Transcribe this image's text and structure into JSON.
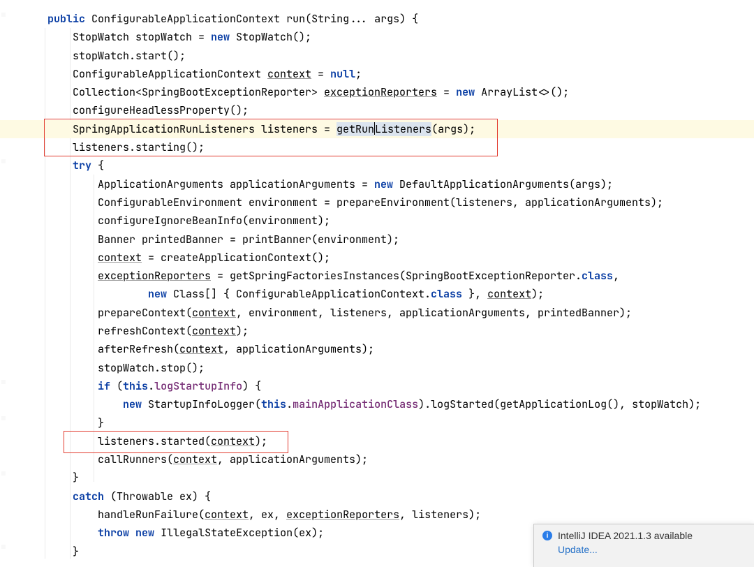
{
  "code": {
    "l1": {
      "kw1": "public",
      "type": "ConfigurableApplicationContext",
      "name": "run",
      "sig": "(String... args) {"
    },
    "l2": {
      "a": "StopWatch stopWatch = ",
      "kw": "new",
      "b": " StopWatch();"
    },
    "l3": "stopWatch.start();",
    "l4": {
      "a": "ConfigurableApplicationContext ",
      "u": "context",
      "b": " = ",
      "kw": "null",
      "c": ";"
    },
    "l5": {
      "a": "Collection<SpringBootExceptionReporter> ",
      "u": "exceptionReporters",
      "b": " = ",
      "kw": "new",
      "c": " ArrayList<>();"
    },
    "l6": "configureHeadlessProperty();",
    "l7": {
      "a": "SpringApplicationRunListeners listeners = ",
      "sel1": "getRun",
      "sel2": "Listeners",
      "b": "(args);"
    },
    "l8": "listeners.starting();",
    "l9": {
      "kw": "try",
      "b": " {"
    },
    "l10": {
      "a": "ApplicationArguments applicationArguments = ",
      "kw": "new",
      "b": " DefaultApplicationArguments(args);"
    },
    "l11": "ConfigurableEnvironment environment = prepareEnvironment(listeners, applicationArguments);",
    "l12": "configureIgnoreBeanInfo(environment);",
    "l13": "Banner printedBanner = printBanner(environment);",
    "l14": {
      "u": "context",
      "b": " = createApplicationContext();"
    },
    "l15": {
      "u": "exceptionReporters",
      "b": " = getSpringFactoriesInstances(SpringBootExceptionReporter.",
      "kw": "class",
      "c": ","
    },
    "l16": {
      "kw": "new",
      "a": " Class[] { ConfigurableApplicationContext.",
      "kw2": "class",
      "b": " }, ",
      "u": "context",
      "c": ");"
    },
    "l17": {
      "a": "prepareContext(",
      "u": "context",
      "b": ", environment, listeners, applicationArguments, printedBanner);"
    },
    "l18": {
      "a": "refreshContext(",
      "u": "context",
      "b": ");"
    },
    "l19": {
      "a": "afterRefresh(",
      "u": "context",
      "b": ", applicationArguments);"
    },
    "l20": "stopWatch.stop();",
    "l21": {
      "kw": "if",
      "a": " (",
      "kw2": "this",
      "b": ".",
      "fld": "logStartupInfo",
      "c": ") {"
    },
    "l22": {
      "kw": "new",
      "a": " StartupInfoLogger(",
      "kw2": "this",
      "b": ".",
      "fld": "mainApplicationClass",
      "c": ").logStarted(getApplicationLog(), stopWatch);"
    },
    "l23": "}",
    "l24": {
      "a": "listeners.started(",
      "u": "context",
      "b": ");"
    },
    "l25": {
      "a": "callRunners(",
      "u": "context",
      "b": ", applicationArguments);"
    },
    "l26": "}",
    "l27": {
      "kw": "catch",
      "a": " (Throwable ex) {"
    },
    "l28": {
      "a": "handleRunFailure(",
      "u": "context",
      "b": ", ex, ",
      "u2": "exceptionReporters",
      "c": ", listeners);"
    },
    "l29": {
      "kw": "throw",
      "a": " ",
      "kw2": "new",
      "b": " IllegalStateException(ex);"
    },
    "l30": "}"
  },
  "indent": {
    "i1": "    ",
    "i2": "        ",
    "i3": "            ",
    "i4": "                ",
    "i5": "                    "
  },
  "toast": {
    "title": "IntelliJ IDEA 2021.1.3 available",
    "action": "Update..."
  },
  "annotations": {
    "box1_desc": "highlight-listeners-init",
    "box2_desc": "highlight-listeners-started"
  },
  "colors": {
    "keyword": "#0a3ea4",
    "field": "#762d75",
    "highlight_bg": "#fefae3",
    "selection_bg": "#dbe4ee",
    "annotation_border": "#e23b2e",
    "link": "#2470c7"
  }
}
